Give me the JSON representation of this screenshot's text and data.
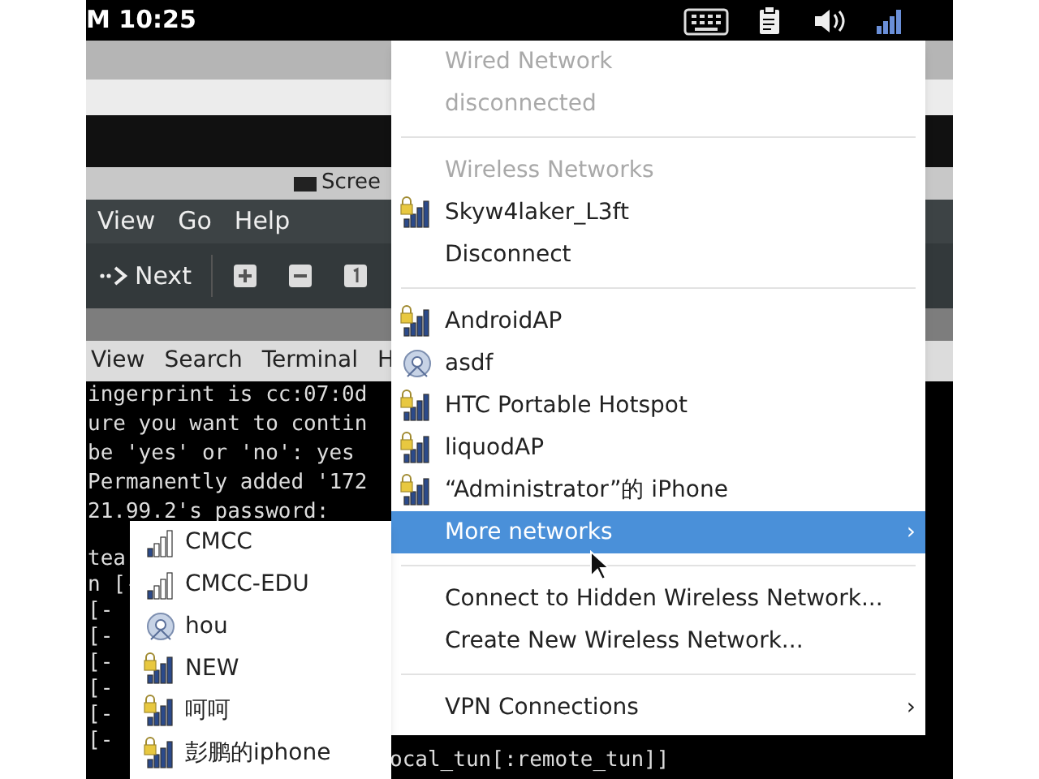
{
  "top_bar": {
    "clock": "M 10:25"
  },
  "background_window": {
    "title": "Scree",
    "menu": [
      "View",
      "Go",
      "Help"
    ],
    "toolbar": {
      "next": "Next"
    }
  },
  "terminal": {
    "menu": [
      "View",
      "Search",
      "Terminal",
      "H"
    ],
    "lines": [
      "ingerprint is cc:07:0d",
      "ure you want to contin",
      "be 'yes' or 'no': yes",
      "Permanently added '172",
      "21.99.2's password:"
    ],
    "lower_lines": [
      "tea",
      "n [-",
      "[-",
      "[-",
      "[-",
      "[-",
      "[-",
      "[-"
    ],
    "tail": "ocal_tun[:remote_tun]]"
  },
  "network_menu": {
    "items": [
      {
        "kind": "header",
        "label": "Wired Network"
      },
      {
        "kind": "header",
        "label": "disconnected"
      },
      {
        "kind": "separator"
      },
      {
        "kind": "header",
        "label": "Wireless Networks"
      },
      {
        "kind": "network",
        "label": "Skyw4laker_L3ft",
        "secured": true,
        "adhoc": false
      },
      {
        "kind": "action",
        "label": "Disconnect"
      },
      {
        "kind": "separator"
      },
      {
        "kind": "network",
        "label": "AndroidAP",
        "secured": true,
        "adhoc": false
      },
      {
        "kind": "network",
        "label": "asdf",
        "secured": false,
        "adhoc": true
      },
      {
        "kind": "network",
        "label": "HTC Portable Hotspot",
        "secured": true,
        "adhoc": false
      },
      {
        "kind": "network",
        "label": "liquodAP",
        "secured": true,
        "adhoc": false
      },
      {
        "kind": "network",
        "label": "“Administrator”的 iPhone",
        "secured": true,
        "adhoc": false
      },
      {
        "kind": "submenu",
        "label": "More networks",
        "arrow": "›",
        "selected": true
      },
      {
        "kind": "separator"
      },
      {
        "kind": "action",
        "label": "Connect to Hidden Wireless Network..."
      },
      {
        "kind": "action",
        "label": "Create New Wireless Network..."
      },
      {
        "kind": "separator"
      },
      {
        "kind": "submenu",
        "label": "VPN Connections",
        "arrow": "›",
        "selected": false
      }
    ]
  },
  "more_networks_menu": {
    "items": [
      {
        "label": "CMCC",
        "secured": false,
        "adhoc": false
      },
      {
        "label": "CMCC-EDU",
        "secured": false,
        "adhoc": false
      },
      {
        "label": "hou",
        "secured": false,
        "adhoc": true
      },
      {
        "label": "NEW",
        "secured": true,
        "adhoc": false
      },
      {
        "label": "呵呵",
        "secured": true,
        "adhoc": false
      },
      {
        "label": "彭鹏的iphone",
        "secured": true,
        "adhoc": false
      }
    ]
  }
}
